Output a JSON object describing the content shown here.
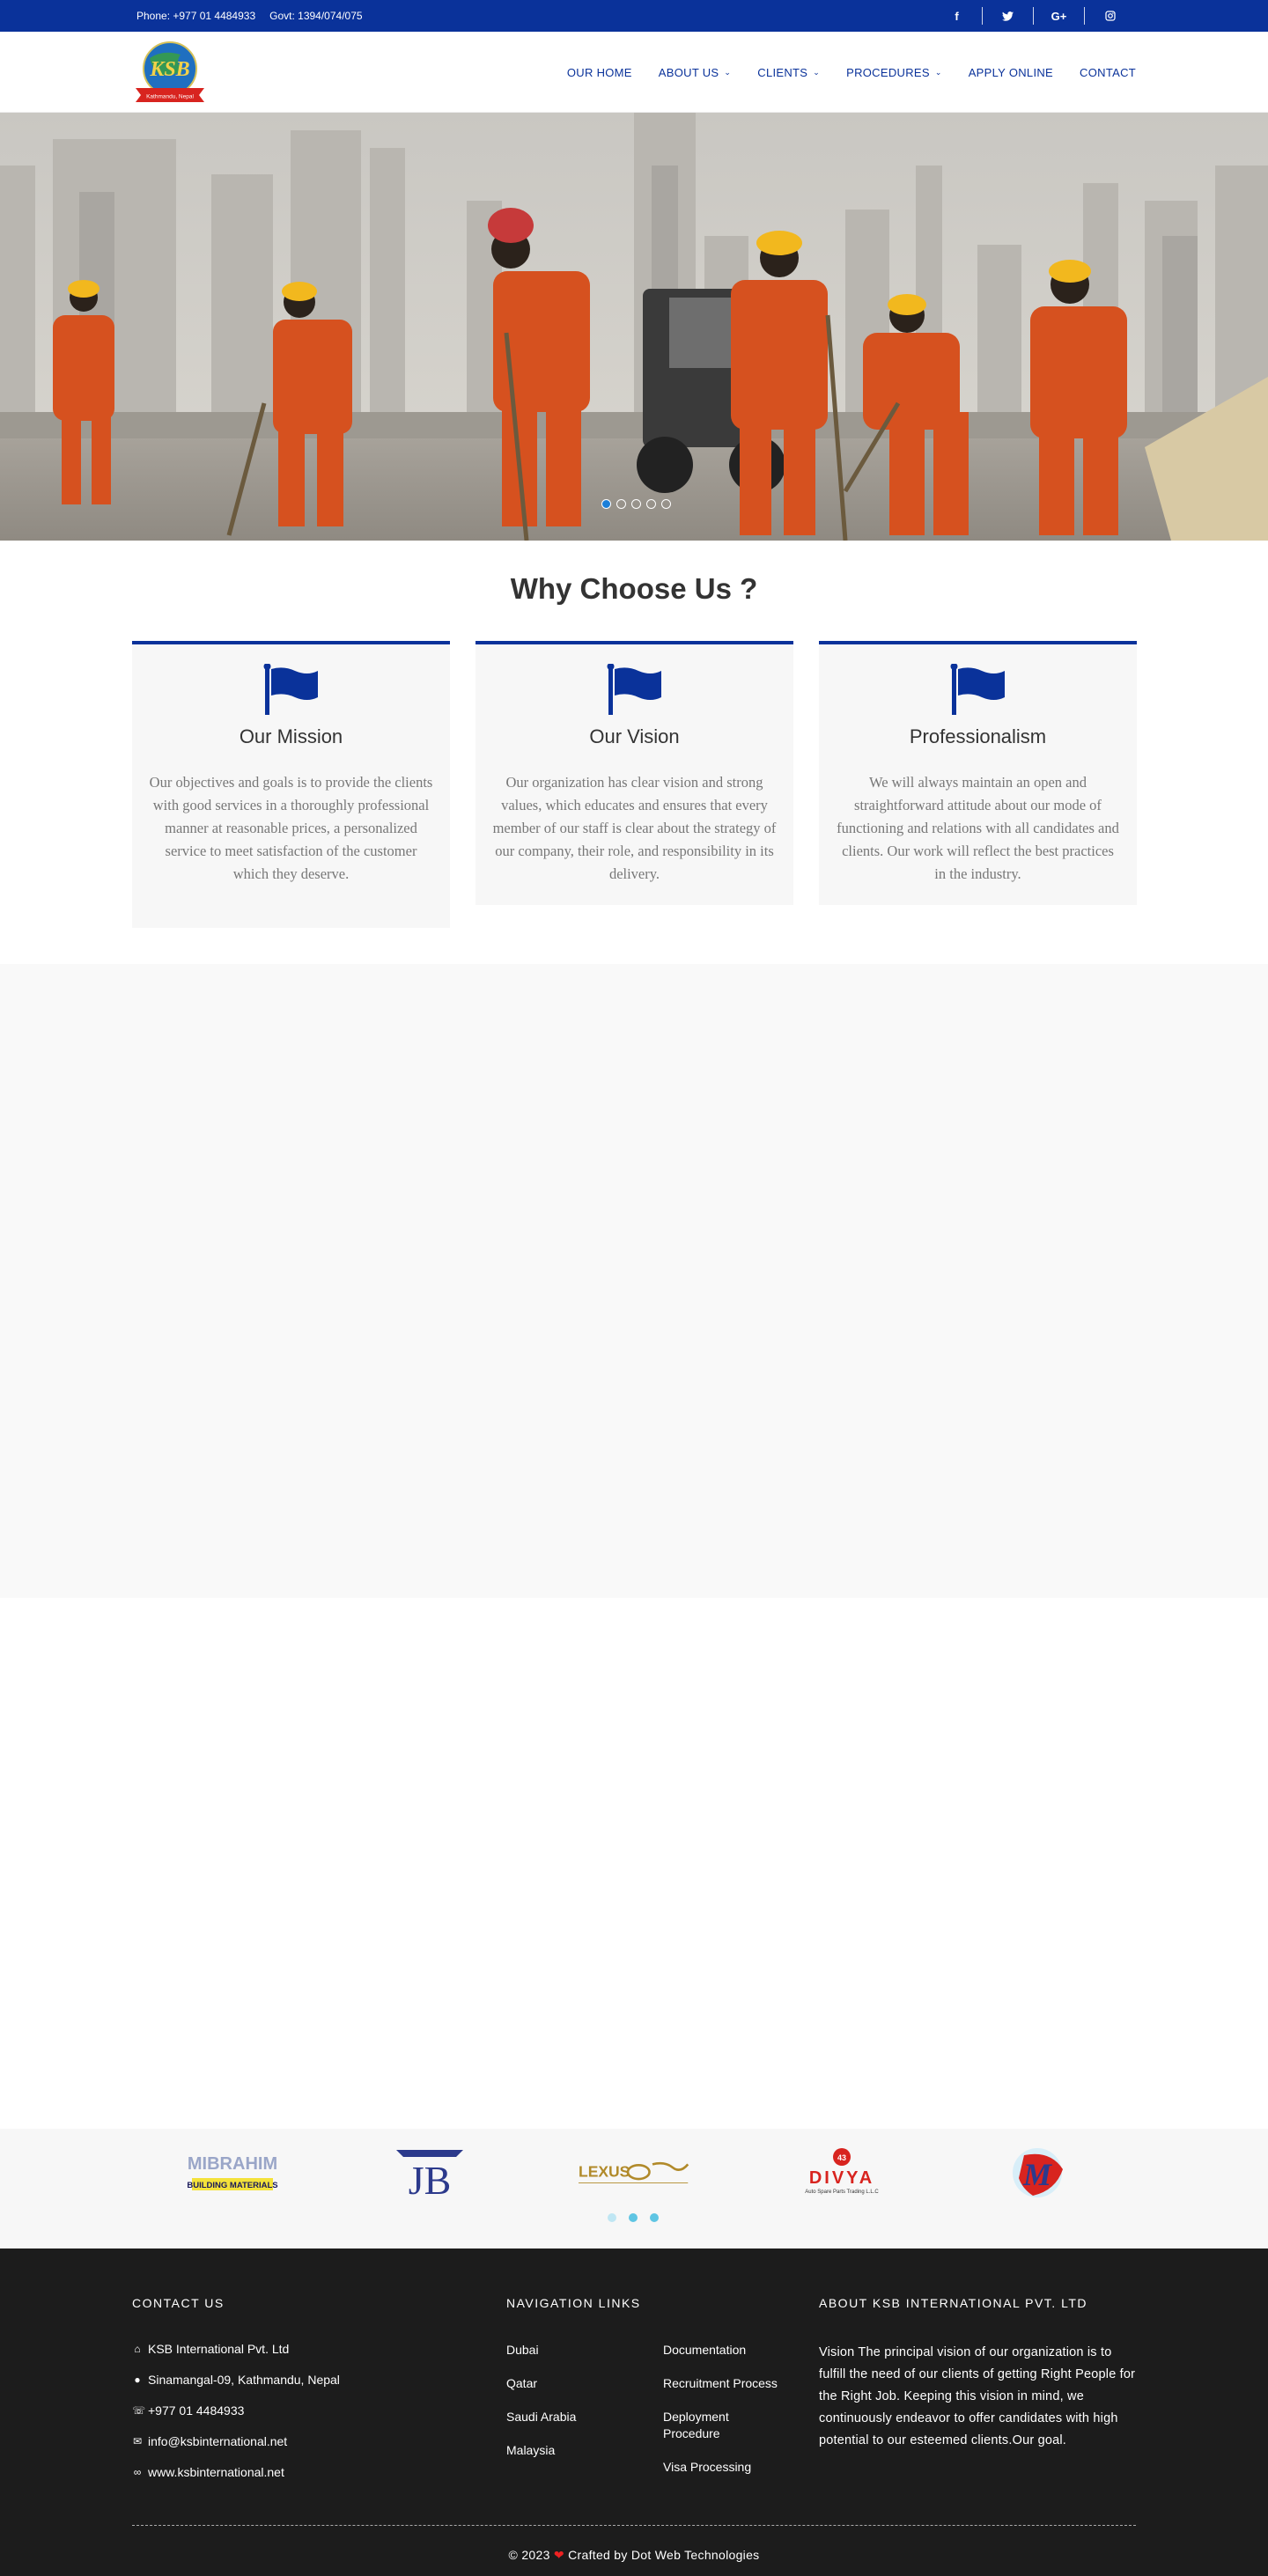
{
  "topbar": {
    "phone": "Phone: +977 01 4484933",
    "govt": "Govt: 1394/074/075",
    "social_icons": [
      "facebook-icon",
      "twitter-icon",
      "google-plus-icon",
      "instagram-icon"
    ],
    "social_glyphs": [
      "f",
      "🐦",
      "G+",
      "◎"
    ]
  },
  "header": {
    "logo_text": "KSB",
    "logo_ribbon": "Kathmandu, Nepal",
    "nav": [
      {
        "label": "OUR HOME",
        "dropdown": false
      },
      {
        "label": "ABOUT US",
        "dropdown": true
      },
      {
        "label": "CLIENTS",
        "dropdown": true
      },
      {
        "label": "PROCEDURES",
        "dropdown": true
      },
      {
        "label": "APPLY ONLINE",
        "dropdown": false
      },
      {
        "label": "CONTACT",
        "dropdown": false
      }
    ]
  },
  "hero": {
    "slide_count": 5,
    "active_slide": 1
  },
  "why": {
    "title": "Why Choose Us ?",
    "cards": [
      {
        "title": "Our Mission",
        "text": "Our objectives and goals is to provide the clients with good services in a thoroughly professional manner at reasonable prices, a personalized service to meet satisfaction of the customer which they deserve."
      },
      {
        "title": "Our Vision",
        "text": "Our organization has clear vision and strong values, which educates and ensures that every member of our staff is clear about the strategy of our company, their role, and responsibility in its delivery."
      },
      {
        "title": "Professionalism",
        "text": "We will always maintain an open and straightforward attitude about our mode of functioning and relations with all candidates and clients. Our work will reflect the best practices in the industry."
      }
    ]
  },
  "clients": {
    "logos": [
      {
        "name": "mibrahim",
        "top": "MIBRAHIM",
        "bottom": "BUILDING MATERIALS"
      },
      {
        "name": "jb",
        "top": "JB",
        "bottom": ""
      },
      {
        "name": "lexus",
        "top": "LEXUS",
        "bottom": ""
      },
      {
        "name": "divya",
        "top": "DIVYA",
        "bottom": "Auto Spare Parts Trading L.L.C"
      },
      {
        "name": "m-globe",
        "top": "M",
        "bottom": ""
      }
    ],
    "slider_dots": 3,
    "active_dot": 2
  },
  "footer": {
    "contact": {
      "heading": "CONTACT US",
      "company": "KSB International Pvt. Ltd",
      "address": "Sinamangal-09, Kathmandu, Nepal",
      "phone": "+977 01 4484933",
      "email": "info@ksbinternational.net",
      "website": "www.ksbinternational.net"
    },
    "navigation": {
      "heading": "NAVIGATION LINKS",
      "col1": [
        "Dubai",
        "Qatar",
        "Saudi Arabia",
        "Malaysia"
      ],
      "col2": [
        "Documentation",
        "Recruitment Process",
        "Deployment Procedure",
        "Visa Processing"
      ]
    },
    "about": {
      "heading": "ABOUT KSB INTERNATIONAL PVT. LTD",
      "text": "Vision The principal vision of our organization is to fulfill the need of our clients of getting Right People for the Right Job. Keeping this vision in mind, we continuously endeavor to offer candidates with high potential to our esteemed clients.Our goal."
    },
    "copyright_prefix": "© 2023",
    "copyright_suffix": "Crafted by Dot Web Technologies"
  },
  "colors": {
    "brand_blue": "#0a329a",
    "footer_bg": "#1c1c1c",
    "card_bg": "#f7f7f7"
  }
}
